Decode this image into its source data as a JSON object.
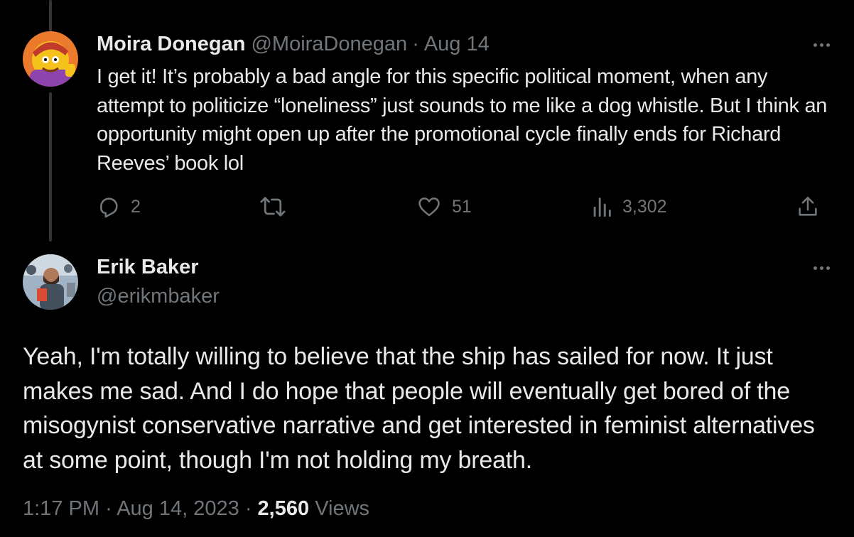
{
  "reply": {
    "author_name": "Moira Donegan",
    "handle": "@MoiraDonegan",
    "separator": "·",
    "date": "Aug 14",
    "text": "I get it! It’s probably a bad angle for this specific political moment, when any attempt to politicize “loneliness” just sounds to me like a dog whistle. But I think an opportunity might open up after the promotional cycle finally ends for Richard Reeves’ book lol",
    "replies_count": "2",
    "retweets_count": "",
    "likes_count": "51",
    "views_count": "3,302"
  },
  "tweet": {
    "author_name": "Erik Baker",
    "handle": "@erikmbaker",
    "text": "Yeah, I'm totally willing to believe that the ship has sailed for now. It just makes me sad. And I do hope that people will eventually get bored of the misogynist conservative narrative and get interested in feminist alternatives at some point, though I'm not holding my breath.",
    "time": "1:17 PM",
    "separator": "·",
    "date": "Aug 14, 2023",
    "views_count": "2,560",
    "views_label": "Views"
  },
  "icons": {
    "reply": "reply-icon",
    "retweet": "retweet-icon",
    "like": "heart-icon",
    "views": "views-icon",
    "share": "share-icon",
    "more": "more-icon"
  },
  "colors": {
    "background": "#000000",
    "text": "#e7e9ea",
    "muted": "#71767b",
    "thread_line": "#333639"
  }
}
